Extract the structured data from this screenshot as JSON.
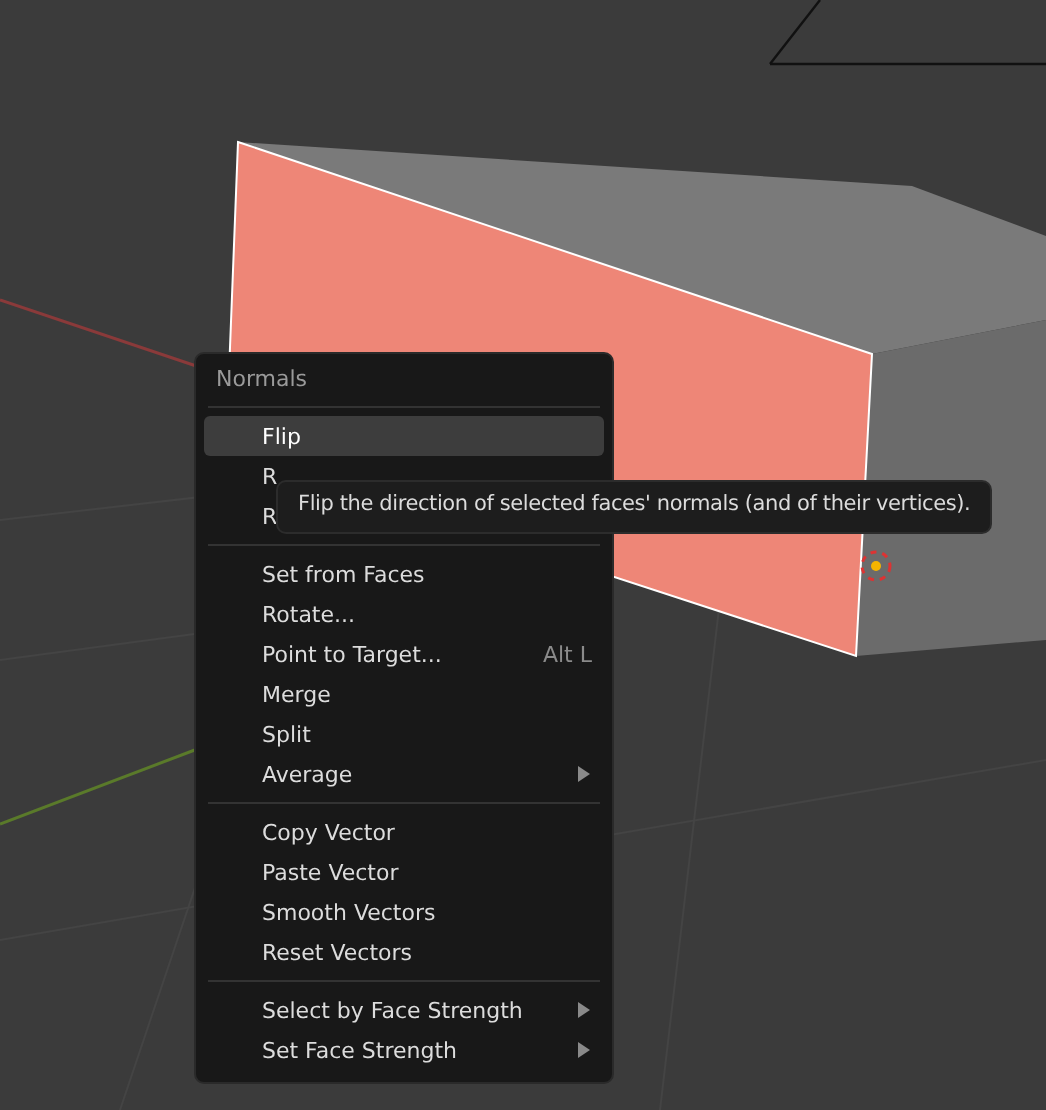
{
  "menu": {
    "title": "Normals",
    "sections": [
      {
        "items": [
          {
            "label": "Flip",
            "selected": true,
            "submenu": false
          },
          {
            "label": "R",
            "selected": false,
            "submenu": false
          },
          {
            "label": "R",
            "selected": false,
            "submenu": false
          }
        ]
      },
      {
        "items": [
          {
            "label": "Set from Faces",
            "selected": false,
            "submenu": false
          },
          {
            "label": "Rotate...",
            "selected": false,
            "submenu": false
          },
          {
            "label": "Point to Target...",
            "shortcut": "Alt L",
            "selected": false,
            "submenu": false
          },
          {
            "label": "Merge",
            "selected": false,
            "submenu": false
          },
          {
            "label": "Split",
            "selected": false,
            "submenu": false
          },
          {
            "label": "Average",
            "selected": false,
            "submenu": true
          }
        ]
      },
      {
        "items": [
          {
            "label": "Copy Vector",
            "selected": false,
            "submenu": false
          },
          {
            "label": "Paste Vector",
            "selected": false,
            "submenu": false
          },
          {
            "label": "Smooth Vectors",
            "selected": false,
            "submenu": false
          },
          {
            "label": "Reset Vectors",
            "selected": false,
            "submenu": false
          }
        ]
      },
      {
        "items": [
          {
            "label": "Select by Face Strength",
            "selected": false,
            "submenu": true
          },
          {
            "label": "Set Face Strength",
            "selected": false,
            "submenu": true
          }
        ]
      }
    ]
  },
  "tooltip": {
    "text": "Flip the direction of selected faces' normals (and of their vertices)."
  }
}
